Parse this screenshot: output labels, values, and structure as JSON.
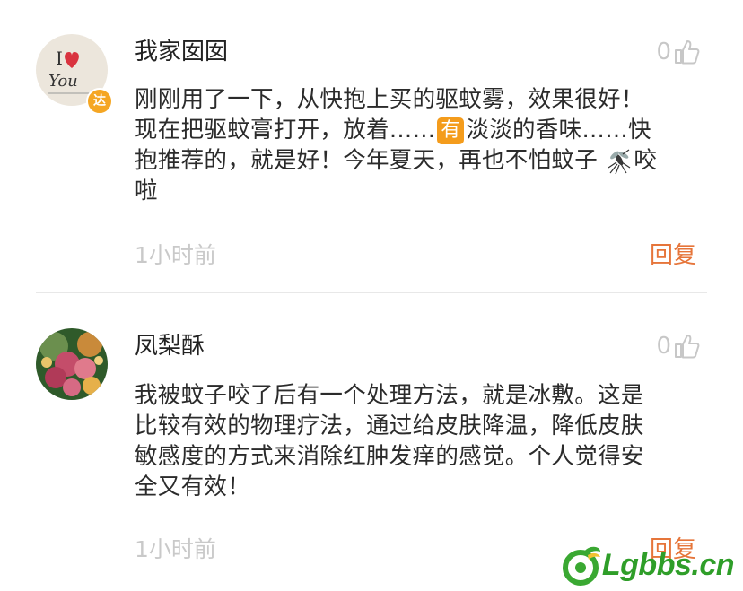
{
  "comments": [
    {
      "username": "我家囡囡",
      "verified_badge": "达",
      "avatar_text": {
        "i": "I",
        "you": "You"
      },
      "like_count": "0",
      "lines": [
        {
          "pre": "刚刚用了一下，从快抱上买的驱蚊雾，效果很好！"
        },
        {
          "pre": "现在把驱蚊膏打开，放着……",
          "emoji": "有",
          "post": "淡淡的香味……快"
        },
        {
          "pre": "抱推荐的，就是好！今年夏天，再也不怕蚊子",
          "post": "咬"
        },
        {
          "pre": "啦"
        }
      ],
      "time": "1小时前",
      "reply_label": "回复"
    },
    {
      "username": "凤梨酥",
      "like_count": "0",
      "lines": [
        {
          "pre": "我被蚊子咬了后有一个处理方法，就是冰敷。这是"
        },
        {
          "pre": "比较有效的物理疗法，通过给皮肤降温，降低皮肤"
        },
        {
          "pre": "敏感度的方式来消除红肿发痒的感觉。个人觉得安"
        },
        {
          "pre": "全又有效！"
        }
      ],
      "time": "1小时前",
      "reply_label": "回复"
    }
  ],
  "watermark": {
    "text": "Lgbbs.cn"
  },
  "icons": [
    "thumb-up-icon",
    "mosquito-icon",
    "watermark-logo-icon"
  ],
  "colors": {
    "reply": "#e6753a",
    "time": "#c9c9c9",
    "badge": "#f5a623",
    "watermark": "#2f9e29"
  }
}
